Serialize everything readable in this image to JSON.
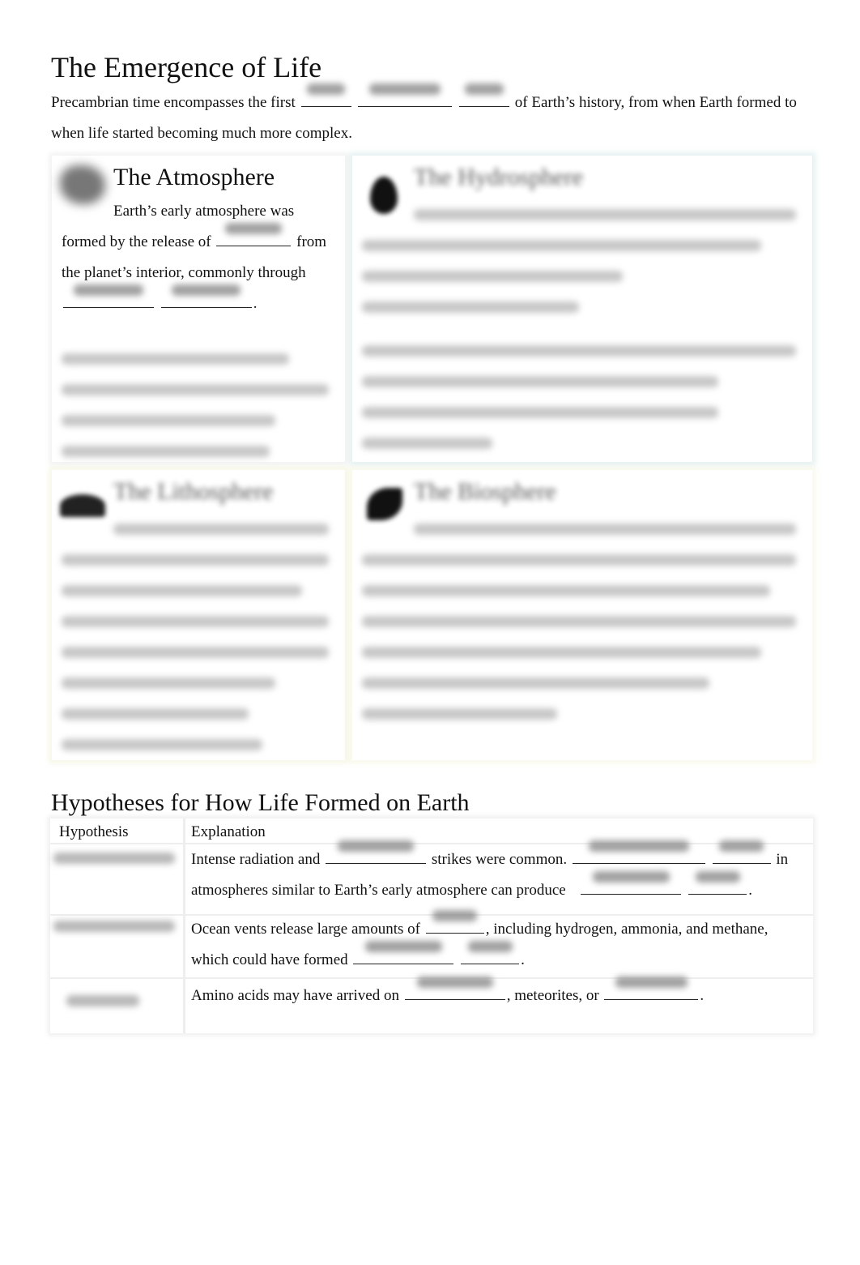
{
  "title": "The Emergence of Life",
  "intro": {
    "before": "Precambrian time encompasses the first",
    "after": "of Earth’s history, from when Earth formed to when life started becoming much more complex."
  },
  "sections": {
    "atmosphere": {
      "title": "The Atmosphere",
      "text1": "Earth’s early atmosphere was formed by the release of",
      "text2": "from the planet’s interior, commonly through",
      "text3": "."
    },
    "hydrosphere": {
      "title": "The Hydrosphere"
    },
    "lithosphere": {
      "title": "The Lithosphere"
    },
    "biosphere": {
      "title": "The Biosphere"
    }
  },
  "hypotheses": {
    "heading": "Hypotheses for How Life Formed on Earth",
    "col_hypothesis": "Hypothesis",
    "col_explanation": "Explanation",
    "rows": [
      {
        "p1": "Intense radiation and",
        "p2": "strikes were common.",
        "p3": "in atmospheres similar to Earth’s early atmosphere can produce",
        "p4": "."
      },
      {
        "p1": "Ocean vents release large amounts of",
        "p2": ", including hydrogen, ammonia, and methane, which could have formed",
        "p3": "."
      },
      {
        "p1": "Amino acids may have arrived on",
        "p2": ", meteorites, or",
        "p3": "."
      }
    ]
  }
}
